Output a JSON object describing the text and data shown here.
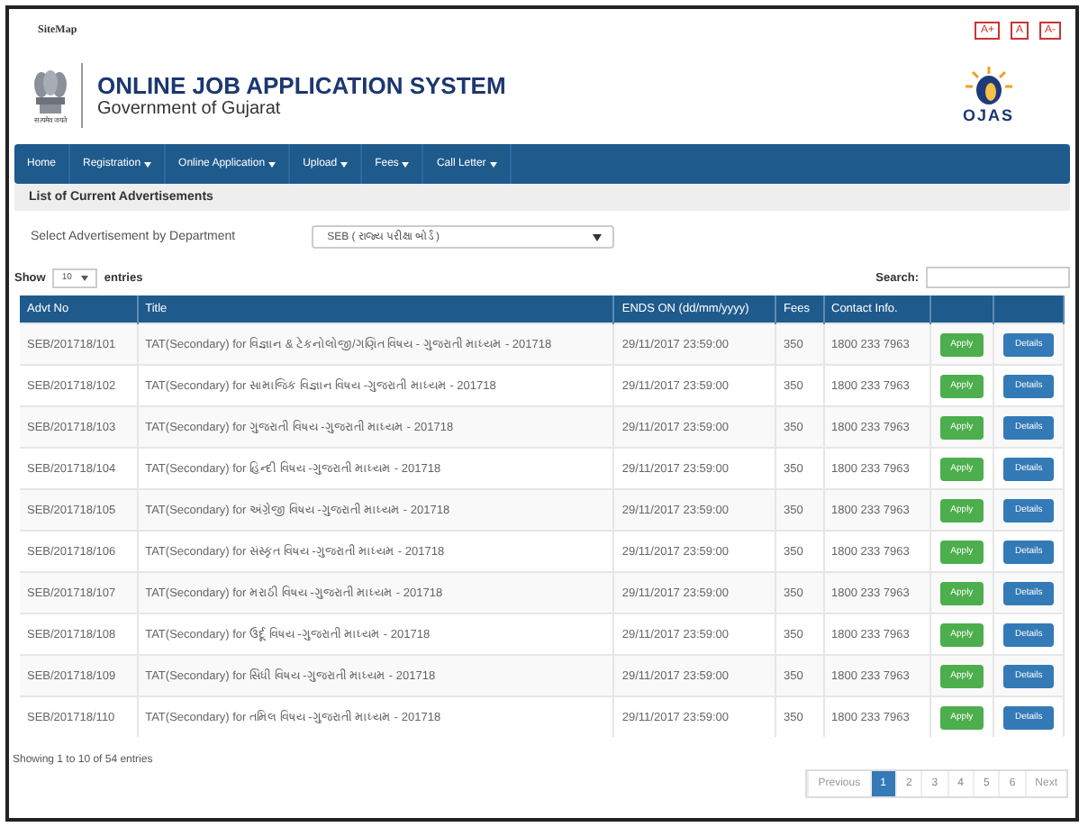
{
  "top_bar": {
    "sitemap": "SiteMap",
    "font_buttons": [
      "A+",
      "A",
      "A-"
    ]
  },
  "header": {
    "emblem_caption": "सत्यमेव जयते",
    "title": "ONLINE JOB APPLICATION SYSTEM",
    "subtitle": "Government of Gujarat",
    "logo_text": "OJAS"
  },
  "nav": [
    {
      "label": "Home",
      "dropdown": false
    },
    {
      "label": "Registration",
      "dropdown": true
    },
    {
      "label": "Online Application",
      "dropdown": true
    },
    {
      "label": "Upload",
      "dropdown": true
    },
    {
      "label": "Fees",
      "dropdown": true
    },
    {
      "label": "Call Letter",
      "dropdown": true
    }
  ],
  "section_title": "List of Current Advertisements",
  "filter": {
    "label": "Select Advertisement by Department",
    "value": "SEB ( રાજ્ય પરીક્ષા બોર્ડ )"
  },
  "length": {
    "before": "Show",
    "value": "10",
    "after": "entries"
  },
  "search": {
    "label": "Search:"
  },
  "table": {
    "columns": [
      "Advt No",
      "Title",
      "ENDS ON (dd/mm/yyyy)",
      "Fees",
      "Contact Info."
    ],
    "rows": [
      {
        "advt": "SEB/201718/101",
        "title": "TAT(Secondary) for વિજ્ઞાન & ટેકનોલોજી/ગણિત વિષય - ગુજરાતી માધ્યમ - 201718",
        "ends": "29/11/2017 23:59:00",
        "fees": "350",
        "contact": "1800 233 7963",
        "apply": "Apply",
        "details": "Details"
      },
      {
        "advt": "SEB/201718/102",
        "title": "TAT(Secondary) for સામાજિક વિજ્ઞાન વિષય -ગુજરાતી માધ્યમ - 201718",
        "ends": "29/11/2017 23:59:00",
        "fees": "350",
        "contact": "1800 233 7963",
        "apply": "Apply",
        "details": "Details"
      },
      {
        "advt": "SEB/201718/103",
        "title": "TAT(Secondary) for ગુજરાતી વિષય -ગુજરાતી માધ્યમ - 201718",
        "ends": "29/11/2017 23:59:00",
        "fees": "350",
        "contact": "1800 233 7963",
        "apply": "Apply",
        "details": "Details"
      },
      {
        "advt": "SEB/201718/104",
        "title": "TAT(Secondary) for હિન્દી વિષય -ગુજરાતી માધ્યમ - 201718",
        "ends": "29/11/2017 23:59:00",
        "fees": "350",
        "contact": "1800 233 7963",
        "apply": "Apply",
        "details": "Details"
      },
      {
        "advt": "SEB/201718/105",
        "title": "TAT(Secondary) for અંગ્રેજી વિષય -ગુજરાતી માધ્યમ - 201718",
        "ends": "29/11/2017 23:59:00",
        "fees": "350",
        "contact": "1800 233 7963",
        "apply": "Apply",
        "details": "Details"
      },
      {
        "advt": "SEB/201718/106",
        "title": "TAT(Secondary) for સંસ્કૃત વિષય -ગુજરાતી માધ્યમ - 201718",
        "ends": "29/11/2017 23:59:00",
        "fees": "350",
        "contact": "1800 233 7963",
        "apply": "Apply",
        "details": "Details"
      },
      {
        "advt": "SEB/201718/107",
        "title": "TAT(Secondary) for મરાઠી વિષય -ગુજરાતી માધ્યમ - 201718",
        "ends": "29/11/2017 23:59:00",
        "fees": "350",
        "contact": "1800 233 7963",
        "apply": "Apply",
        "details": "Details"
      },
      {
        "advt": "SEB/201718/108",
        "title": "TAT(Secondary) for ઉર્દૂ વિષય -ગુજરાતી માધ્યમ - 201718",
        "ends": "29/11/2017 23:59:00",
        "fees": "350",
        "contact": "1800 233 7963",
        "apply": "Apply",
        "details": "Details"
      },
      {
        "advt": "SEB/201718/109",
        "title": "TAT(Secondary) for સિંધી વિષય -ગુજરાતી માધ્યમ - 201718",
        "ends": "29/11/2017 23:59:00",
        "fees": "350",
        "contact": "1800 233 7963",
        "apply": "Apply",
        "details": "Details"
      },
      {
        "advt": "SEB/201718/110",
        "title": "TAT(Secondary) for તમિલ વિષય -ગુજરાતી માધ્યમ - 201718",
        "ends": "29/11/2017 23:59:00",
        "fees": "350",
        "contact": "1800 233 7963",
        "apply": "Apply",
        "details": "Details"
      }
    ]
  },
  "info": "Showing 1 to 10 of 54 entries",
  "pagination": {
    "previous": "Previous",
    "pages": [
      {
        "label": "1",
        "selected": true
      },
      {
        "label": "2",
        "selected": false
      },
      {
        "label": "3",
        "selected": false
      },
      {
        "label": "4",
        "selected": false
      },
      {
        "label": "5",
        "selected": false
      },
      {
        "label": "6",
        "selected": false
      }
    ],
    "next": "Next"
  }
}
